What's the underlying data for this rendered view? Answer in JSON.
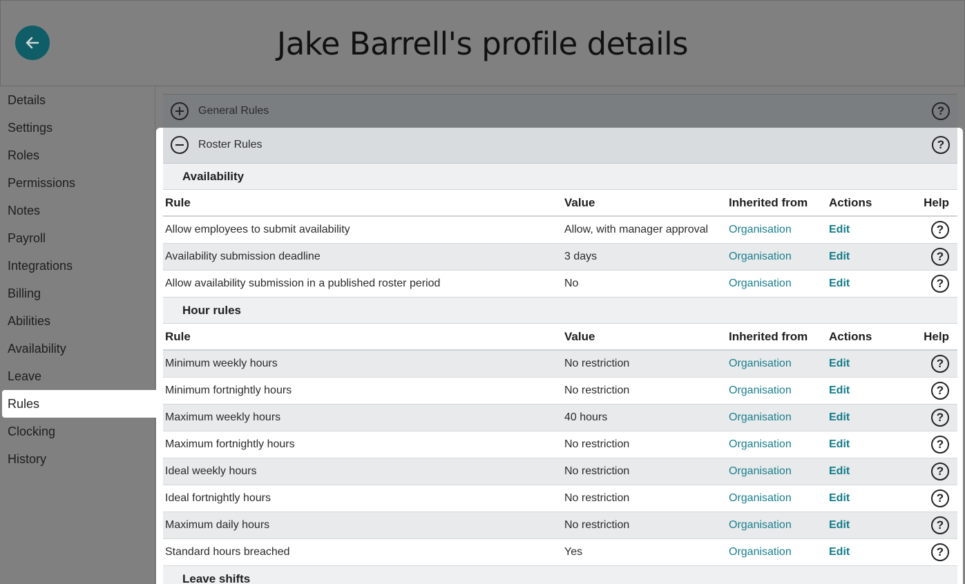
{
  "header": {
    "title": "Jake Barrell's profile details"
  },
  "sidebar": {
    "items": [
      {
        "label": "Details"
      },
      {
        "label": "Settings"
      },
      {
        "label": "Roles"
      },
      {
        "label": "Permissions"
      },
      {
        "label": "Notes"
      },
      {
        "label": "Payroll"
      },
      {
        "label": "Integrations"
      },
      {
        "label": "Billing"
      },
      {
        "label": "Abilities"
      },
      {
        "label": "Availability"
      },
      {
        "label": "Leave"
      },
      {
        "label": "Rules"
      },
      {
        "label": "Clocking"
      },
      {
        "label": "History"
      }
    ],
    "active": "Rules"
  },
  "panels": {
    "general": {
      "label": "General Rules"
    },
    "roster": {
      "label": "Roster Rules"
    }
  },
  "columns": {
    "rule": "Rule",
    "value": "Value",
    "inherited": "Inherited from",
    "actions": "Actions",
    "help": "Help"
  },
  "help_glyph": "?",
  "sections": [
    {
      "title": "Availability",
      "rows": [
        {
          "rule": "Allow employees to submit availability",
          "value": "Allow, with manager approval",
          "inherited": "Organisation",
          "action": "Edit"
        },
        {
          "rule": "Availability submission deadline",
          "value": "3 days",
          "inherited": "Organisation",
          "action": "Edit"
        },
        {
          "rule": "Allow availability submission in a published roster period",
          "value": "No",
          "inherited": "Organisation",
          "action": "Edit"
        }
      ]
    },
    {
      "title": "Hour rules",
      "rows": [
        {
          "rule": "Minimum weekly hours",
          "value": "No restriction",
          "inherited": "Organisation",
          "action": "Edit"
        },
        {
          "rule": "Minimum fortnightly hours",
          "value": "No restriction",
          "inherited": "Organisation",
          "action": "Edit"
        },
        {
          "rule": "Maximum weekly hours",
          "value": "40 hours",
          "inherited": "Organisation",
          "action": "Edit"
        },
        {
          "rule": "Maximum fortnightly hours",
          "value": "No restriction",
          "inherited": "Organisation",
          "action": "Edit"
        },
        {
          "rule": "Ideal weekly hours",
          "value": "No restriction",
          "inherited": "Organisation",
          "action": "Edit"
        },
        {
          "rule": "Ideal fortnightly hours",
          "value": "No restriction",
          "inherited": "Organisation",
          "action": "Edit"
        },
        {
          "rule": "Maximum daily hours",
          "value": "No restriction",
          "inherited": "Organisation",
          "action": "Edit"
        },
        {
          "rule": "Standard hours breached",
          "value": "Yes",
          "inherited": "Organisation",
          "action": "Edit"
        }
      ]
    },
    {
      "title": "Leave shifts",
      "rows": []
    }
  ]
}
